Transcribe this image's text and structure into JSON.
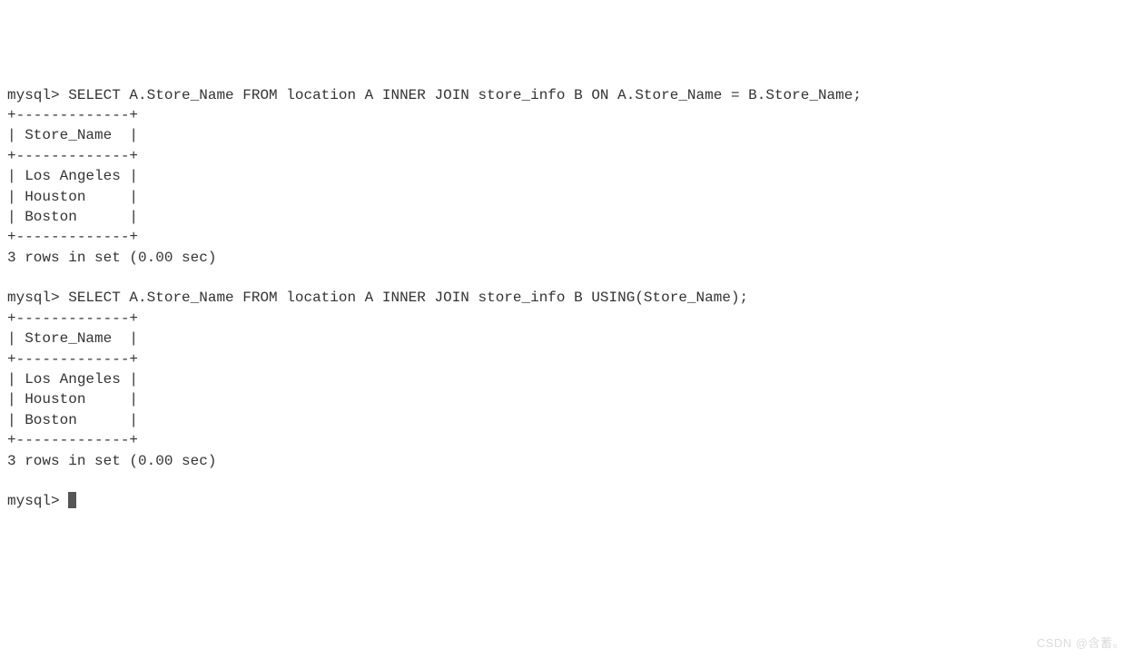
{
  "query1": {
    "prompt": "mysql> ",
    "sql": "SELECT A.Store_Name FROM location A INNER JOIN store_info B ON A.Store_Name = B.Store_Name;",
    "border": "+-------------+",
    "header": "| Store_Name  |",
    "rows": [
      "| Los Angeles |",
      "| Houston     |",
      "| Boston      |"
    ],
    "footer": "3 rows in set (0.00 sec)"
  },
  "query2": {
    "prompt": "mysql> ",
    "sql": "SELECT A.Store_Name FROM location A INNER JOIN store_info B USING(Store_Name);",
    "border": "+-------------+",
    "header": "| Store_Name  |",
    "rows": [
      "| Los Angeles |",
      "| Houston     |",
      "| Boston      |"
    ],
    "footer": "3 rows in set (0.00 sec)"
  },
  "final_prompt": "mysql> ",
  "watermark": "CSDN @含蓄。"
}
